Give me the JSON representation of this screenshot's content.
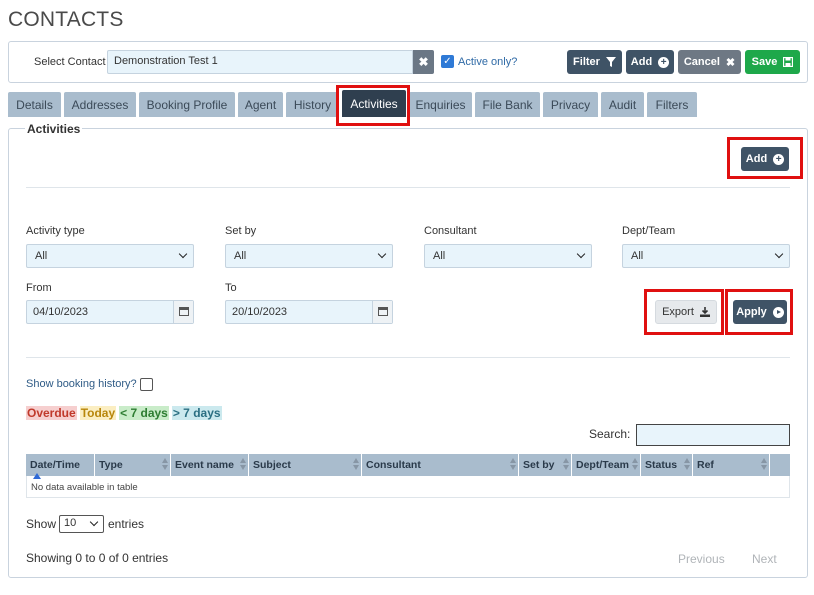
{
  "page": {
    "title": "CONTACTS"
  },
  "contact_bar": {
    "select_label": "Select Contact",
    "contact_value": "Demonstration Test 1",
    "active_only_label": "Active only?",
    "active_only_checked": true,
    "filter_label": "Filter",
    "add_label": "Add",
    "cancel_label": "Cancel",
    "save_label": "Save"
  },
  "tabs": [
    {
      "label": "Details"
    },
    {
      "label": "Addresses"
    },
    {
      "label": "Booking Profile"
    },
    {
      "label": "Agent"
    },
    {
      "label": "History"
    },
    {
      "label": "Activities",
      "active": true
    },
    {
      "label": "Enquiries"
    },
    {
      "label": "File Bank"
    },
    {
      "label": "Privacy"
    },
    {
      "label": "Audit"
    },
    {
      "label": "Filters"
    }
  ],
  "activities": {
    "section_title": "Activities",
    "add_label": "Add",
    "filters": {
      "activity_type": {
        "label": "Activity type",
        "value": "All"
      },
      "set_by": {
        "label": "Set by",
        "value": "All"
      },
      "consultant": {
        "label": "Consultant",
        "value": "All"
      },
      "dept_team": {
        "label": "Dept/Team",
        "value": "All"
      },
      "from": {
        "label": "From",
        "value": "04/10/2023"
      },
      "to": {
        "label": "To",
        "value": "20/10/2023"
      }
    },
    "export_label": "Export",
    "apply_label": "Apply",
    "show_booking_history_label": "Show booking history?",
    "legend": {
      "overdue": "Overdue",
      "today": "Today",
      "lt7": "< 7 days",
      "gt7": "> 7 days"
    },
    "search_label": "Search:",
    "search_value": "",
    "table": {
      "columns": [
        "Date/Time",
        "Type",
        "Event name",
        "Subject",
        "Consultant",
        "Set by",
        "Dept/Team",
        "Status",
        "Ref"
      ],
      "empty_text": "No data available in table"
    },
    "show_label": "Show",
    "page_size": "10",
    "entries_label": "entries",
    "info_text": "Showing 0 to 0 of 0 entries",
    "previous_label": "Previous",
    "next_label": "Next"
  },
  "colors": {
    "highlight_red": "#e01010",
    "tab_bg": "#a9bccd",
    "tab_active_bg": "#2f3f4f",
    "btn_dark": "#3f5366",
    "btn_green": "#1ea84a",
    "overdue_bg": "#f6cfcf",
    "today_bg": "#fbeec2",
    "lt7_bg": "#c9ecc9",
    "gt7_bg": "#cbe9ee"
  }
}
